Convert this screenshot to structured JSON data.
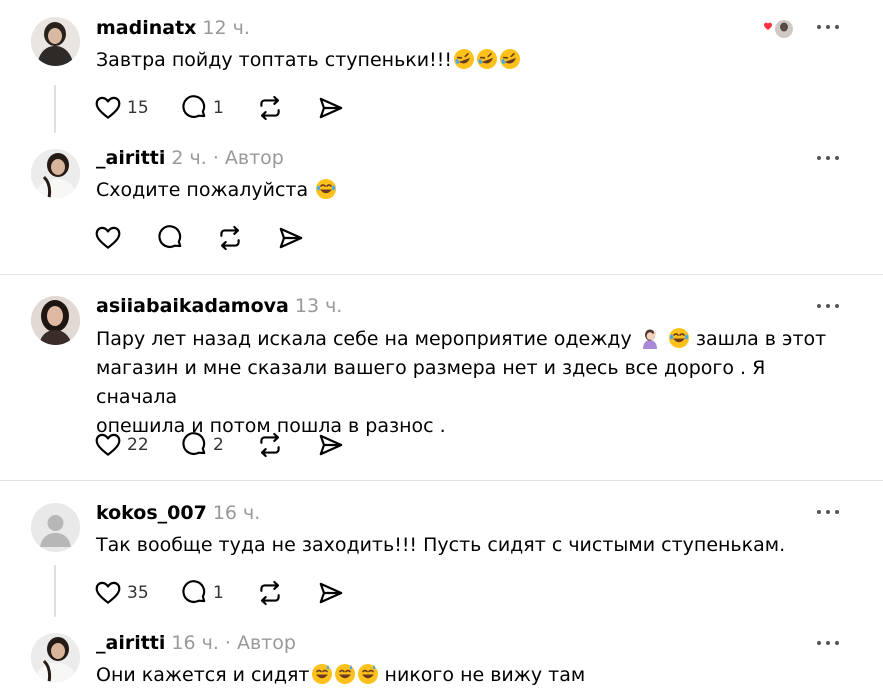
{
  "comments": [
    {
      "username": "madinatx",
      "time": "12 ч.",
      "author_tag": "",
      "text": "Завтра пойду топтать ступеньки!!!",
      "emojis": [
        "rofl",
        "rofl",
        "rofl"
      ],
      "likes": "15",
      "replies": "1"
    },
    {
      "username": "_airitti",
      "time": "2 ч.",
      "author_tag": "· Автор",
      "text": "Сходите пожалуйста",
      "emojis": [
        "joy"
      ],
      "likes": "",
      "replies": ""
    },
    {
      "username": "asiiabaikadamova",
      "time": "13 ч.",
      "author_tag": "",
      "text_line1": "Пару лет назад искала себе на мероприятие одежду",
      "text_line1b": "зашла в этот",
      "text_line2": "магазин и мне сказали вашего размера нет и здесь все дорого . Я сначала",
      "text_line3": "опешила и потом пошла в разнос .",
      "emojis": [
        "facepalm",
        "joy"
      ],
      "likes": "22",
      "replies": "2"
    },
    {
      "username": "kokos_007",
      "time": "16 ч.",
      "author_tag": "",
      "text": "Так вообще туда не заходить!!! Пусть сидят с чистыми ступенькам.",
      "likes": "35",
      "replies": "1"
    },
    {
      "username": "_airitti",
      "time": "16 ч.",
      "author_tag": "· Автор",
      "text_before": "Они кажется и сидят",
      "text_after": "никого не вижу там",
      "emojis": [
        "sweat-smile",
        "sweat-smile",
        "sweat-smile"
      ]
    }
  ],
  "colors": {
    "heart_red": "#ff3040",
    "muted": "#999999",
    "divider": "#e2e2e2"
  }
}
